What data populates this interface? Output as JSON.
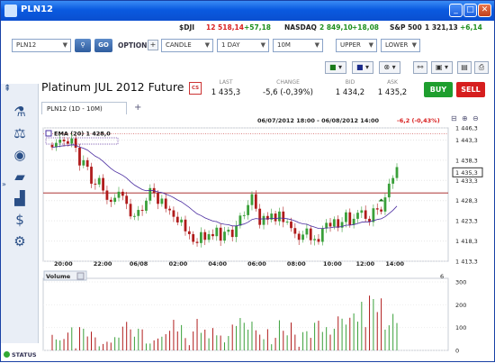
{
  "window": {
    "title": "PLN12",
    "min": "_",
    "max": "□",
    "close": "✕"
  },
  "tickers": [
    {
      "symbol": "$DJI",
      "value": "12 518,14",
      "change": "+57,18",
      "value_color": "neg"
    },
    {
      "symbol": "NASDAQ",
      "value": "2 849,10",
      "change": "+18,08",
      "value_color": "pos"
    },
    {
      "symbol": "S&P 500",
      "value": "1 321,13",
      "change": "+6,14",
      "value_color": ""
    }
  ],
  "toolbar": {
    "symbol": "PLN12",
    "go": "GO",
    "option": "OPTION",
    "chart_type": "CANDLE",
    "period": "1 DAY",
    "interval": "10M",
    "upper": "UPPER",
    "lower": "LOWER"
  },
  "instrument": "Platinum JUL 2012 Future",
  "cs_icon": "CS",
  "quote": {
    "last_label": "LAST",
    "last": "1 435,3",
    "change_label": "CHANGE",
    "change": "-5,6 (-0,39%)",
    "bid_label": "BID",
    "bid": "1 434,2",
    "ask_label": "ASK",
    "ask": "1 435,2"
  },
  "buy": "BUY",
  "sell": "SELL",
  "tab": {
    "label": "PLN12 (1D - 10M)",
    "add": "+"
  },
  "range_text": "06/07/2012 18:00 - 06/08/2012 14:00",
  "range_change": "-6,2 (-0,43%)",
  "ema_label": "EMA (20) 1 428,0",
  "volume_label": "Volume",
  "volume_max_label": "6",
  "status": "STATUS",
  "colors": {
    "accent": "#0a4fd0",
    "up": "#3aa03a",
    "down": "#b01c1c",
    "ema": "#4a2ca0",
    "buy": "#1e9e2e",
    "sell": "#d61e1e"
  },
  "chart_data": {
    "type": "candlestick",
    "x_ticks": [
      "20:00",
      "22:00",
      "06/08",
      "02:00",
      "04:00",
      "06:00",
      "08:00",
      "10:00",
      "12:00",
      "14:00"
    ],
    "y_ticks": [
      "1 446,3",
      "1 443,3",
      "1 438,3",
      "1 433,3",
      "1 428,3",
      "1 423,3",
      "1 418,3",
      "1 413,3"
    ],
    "y_values": [
      1446.3,
      1443.3,
      1438.3,
      1433.3,
      1428.3,
      1423.3,
      1418.3,
      1413.3
    ],
    "ylim": [
      1413.3,
      1446.3
    ],
    "last_marker": "1 435,3",
    "last_value": 1435.3,
    "prev_close": 1430.2,
    "closes": [
      1441.5,
      1442.6,
      1443.4,
      1443.0,
      1442.4,
      1443.7,
      1441.4,
      1437.0,
      1438.3,
      1436.7,
      1432.5,
      1432.3,
      1433.9,
      1430.8,
      1428.5,
      1428.0,
      1429.0,
      1430.5,
      1429.5,
      1427.5,
      1424.4,
      1424.5,
      1426.0,
      1425.8,
      1428.3,
      1431.4,
      1430.2,
      1427.5,
      1428.8,
      1426.3,
      1425.9,
      1424.3,
      1422.9,
      1423.6,
      1420.7,
      1420.0,
      1418.1,
      1417.8,
      1420.5,
      1418.6,
      1420.0,
      1419.5,
      1421.6,
      1418.4,
      1420.6,
      1421.1,
      1419.3,
      1422.1,
      1424.6,
      1424.7,
      1427.2,
      1429.9,
      1426.3,
      1422.3,
      1424.5,
      1423.6,
      1425.1,
      1423.2,
      1425.6,
      1423.0,
      1423.1,
      1421.5,
      1420.1,
      1418.6,
      1419.9,
      1421.4,
      1418.5,
      1418.8,
      1418.1,
      1421.4,
      1422.8,
      1421.9,
      1423.7,
      1421.6,
      1423.0,
      1425.4,
      1422.3,
      1423.8,
      1425.3,
      1425.9,
      1423.8,
      1423.0,
      1426.4,
      1426.1,
      1425.6,
      1429.1,
      1432.5,
      1433.9,
      1436.6
    ],
    "volume_ticks": [
      "300",
      "200",
      "100",
      "0"
    ],
    "volume_ylim": [
      0,
      300
    ],
    "volumes": [
      68,
      48,
      44,
      50,
      78,
      101,
      9,
      102,
      95,
      61,
      82,
      57,
      18,
      28,
      38,
      34,
      58,
      56,
      104,
      125,
      92,
      60,
      95,
      92,
      30,
      30,
      44,
      52,
      60,
      71,
      86,
      134,
      83,
      111,
      54,
      23,
      83,
      138,
      77,
      91,
      53,
      98,
      66,
      65,
      35,
      63,
      113,
      107,
      142,
      121,
      91,
      126,
      88,
      69,
      49,
      93,
      27,
      55,
      132,
      86,
      66,
      122,
      69,
      16,
      80,
      84,
      55,
      121,
      130,
      81,
      102,
      69,
      95,
      149,
      139,
      113,
      143,
      162,
      126,
      213,
      102,
      240,
      225,
      168,
      228,
      91,
      110,
      160,
      120
    ]
  }
}
